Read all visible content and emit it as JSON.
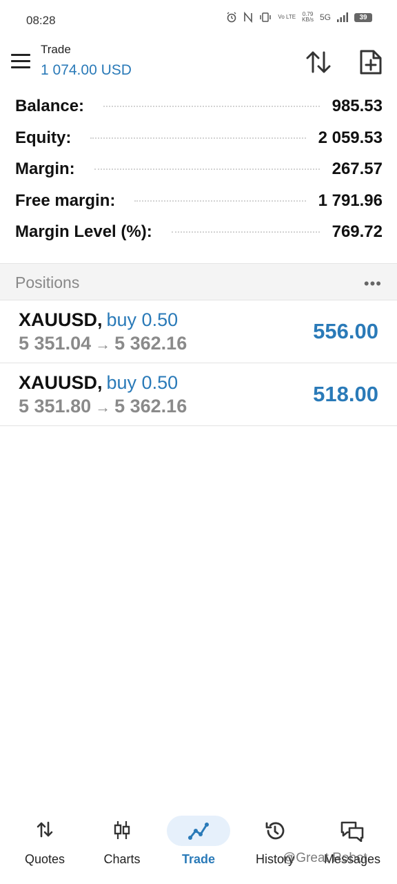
{
  "status": {
    "time": "08:28",
    "speed_value": "0.79",
    "speed_unit": "KB/s",
    "network": "5G",
    "volte": "Vo LTE",
    "battery": "39"
  },
  "header": {
    "title": "Trade",
    "balance": "1 074.00 USD"
  },
  "summary": [
    {
      "label": "Balance:",
      "value": "985.53"
    },
    {
      "label": "Equity:",
      "value": "2 059.53"
    },
    {
      "label": "Margin:",
      "value": "267.57"
    },
    {
      "label": "Free margin:",
      "value": "1 791.96"
    },
    {
      "label": "Margin Level (%):",
      "value": "769.72"
    }
  ],
  "positions": {
    "title": "Positions",
    "more": "•••",
    "items": [
      {
        "symbol": "XAUUSD,",
        "side": "buy 0.50",
        "open_price": "5 351.04",
        "arrow": "→",
        "current_price": "5 362.16",
        "profit": "556.00"
      },
      {
        "symbol": "XAUUSD,",
        "side": "buy 0.50",
        "open_price": "5 351.80",
        "arrow": "→",
        "current_price": "5 362.16",
        "profit": "518.00"
      }
    ]
  },
  "nav": {
    "items": [
      {
        "label": "Quotes",
        "icon": "quotes-icon"
      },
      {
        "label": "Charts",
        "icon": "charts-icon"
      },
      {
        "label": "Trade",
        "icon": "trade-icon",
        "active": true
      },
      {
        "label": "History",
        "icon": "history-icon"
      },
      {
        "label": "Messages",
        "icon": "messages-icon"
      }
    ]
  },
  "watermark": "@Great Robot",
  "colors": {
    "accent": "#2a7ab8",
    "muted": "#8a8a8a",
    "header_bg": "#f4f4f4"
  }
}
